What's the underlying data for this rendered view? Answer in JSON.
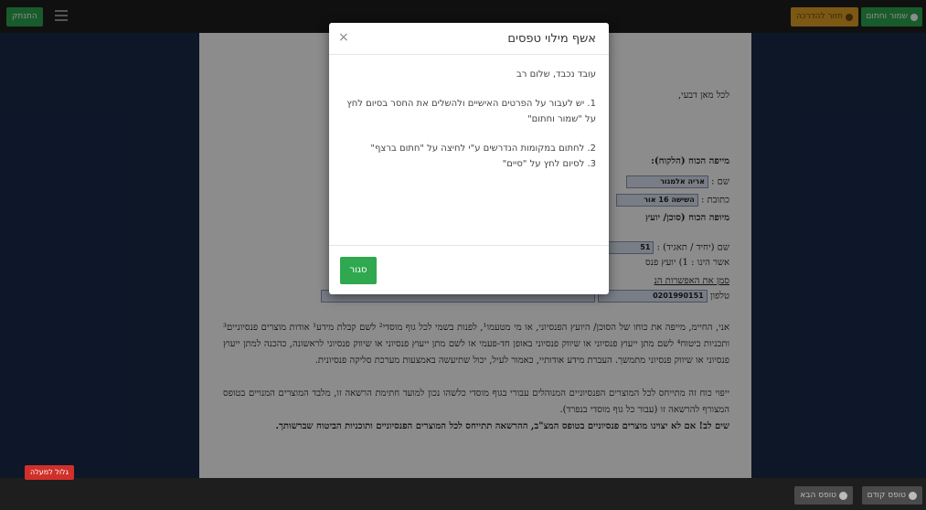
{
  "topbar": {
    "logout_label": "התנתק",
    "save_sign_label": "שמור וחתום",
    "guide_label": "חזור להדרכה"
  },
  "document": {
    "greeting": "לכל מאן דבעי,",
    "section_client": "מייפה הכוח (הלקוח):",
    "name_label": "שם :",
    "name_value": "אריה אלמגור",
    "address_label": "כתובת :",
    "address_value": "השישה 16 אור",
    "section_agent": "מיופה הכוח (סוכן/ יועץ",
    "section_agent_tail": "ינו התאגיד) :",
    "id_value": "51",
    "unit_label": "שם (יחיד / תאגיד) :",
    "license_label": "אשר הינו : 1) יועץ פנס",
    "mark_label": "סמן את האפשרות הנ",
    "phone_label": "טלפון",
    "phone_value": "0201990151",
    "para1": "אני, החיימ, מייפה את כוחו של הסוכן/ היועץ הפנסיוני, או מי מטעמו¹, לפנות בשמי לכל גוף מוסדי² לשם קבלת מידע¹ אודות מוצרים פנסיוניים³ ותכניות ביטוח⁴ לשם מתן ייעוץ פנסיוני או שיווק פנסיוני באופן חד-פעמי או לשם מתן ייעוץ פנסיוני או שיווק פנסיוני לראשונה, כהכנה למתן ייעוץ פנסיוני או שיווק פנסיוני מתמשך. העברת מידע אודותיי, כאמור לעיל, יכול שתיעשה באמצעות מערכת סליקה פנסיונית.",
    "para2": "ייפוי כוח זה מתייחס לכל המוצרים הפנסיוניים המנוהלים עבורי בגוף מוסדי כלשהו נכון למועד חתימת הרשאה זו, מלבד המוצרים המנויים בטופס המצורף להרשאה זו (עבור כל גוף מוסדי בנפרד).",
    "para3": "שים לב! אם לא יצוינו מוצרים פנסיוניים בטופס המצ\"ב, ההרשאה תתייחס לכל המוצרים הפנסיוניים ותוכניות הביטוח שברשותך."
  },
  "modal": {
    "title": "אשף מילוי טפסים",
    "greeting": "עובד נכבד, שלום רב",
    "step1": "1. יש לעבור על הפרטים האישיים ולהשלים את החסר בסיום לחץ על \"שמור וחתום\"",
    "step2": "2. לחתום במקומות הנדרשים ע\"י לחיצה על \"חתום ברצף\"",
    "step3": "3. לסיום לחץ על \"סיים\"",
    "close_label": "סגור",
    "close_icon": "×"
  },
  "bottombar": {
    "scroll_top_label": "גלול למעלה",
    "prev_form_label": "טופס קודם",
    "next_form_label": "טופס הבא"
  }
}
